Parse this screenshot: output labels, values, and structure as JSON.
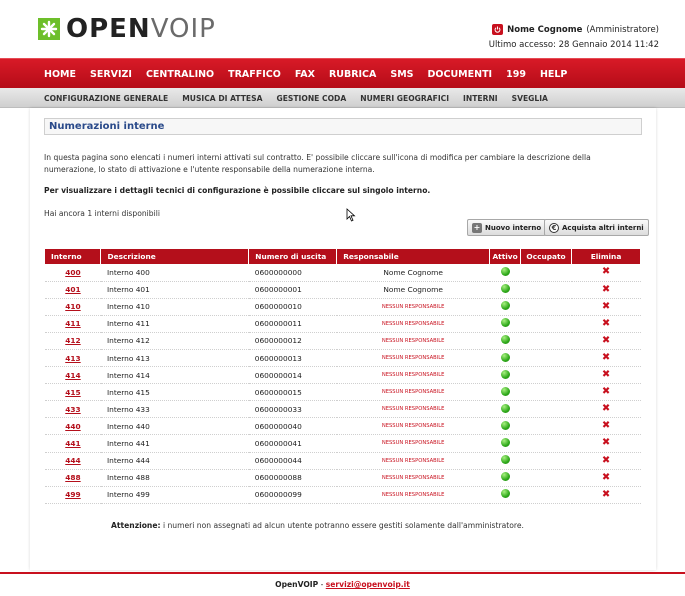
{
  "logo": {
    "word1": "OPEN",
    "word2": "VOIP"
  },
  "user": {
    "name": "Nome Cognome",
    "role": "(Amministratore)",
    "last_access": "Ultimo accesso: 28 Gennaio 2014 11:42"
  },
  "main_nav": [
    "HOME",
    "SERVIZI",
    "CENTRALINO",
    "TRAFFICO",
    "FAX",
    "RUBRICA",
    "SMS",
    "DOCUMENTI",
    "199",
    "HELP"
  ],
  "sub_nav": [
    "CONFIGURAZIONE GENERALE",
    "MUSICA DI ATTESA",
    "GESTIONE CODA",
    "NUMERI GEOGRAFICI",
    "INTERNI",
    "SVEGLIA"
  ],
  "page": {
    "title": "Numerazioni interne",
    "intro": "In questa pagina sono elencati i numeri interni attivati sul contratto. E' possibile cliccare sull'icona di modifica per cambiare la descrizione della numerazione, lo stato di attivazione e l'utente responsabile della numerazione interna.",
    "note": "Per visualizzare i dettagli tecnici di configurazione è possibile cliccare sul singolo interno.",
    "available": "Hai ancora 1 interni disponibili",
    "btn_new": "Nuovo interno",
    "btn_buy": "Acquista altri interni"
  },
  "table": {
    "headers": [
      "Interno",
      "Descrizione",
      "Numero di uscita",
      "Responsabile",
      "Attivo",
      "Occupato",
      "Elimina"
    ],
    "rows": [
      {
        "interno": "400",
        "descrizione": "Interno 400",
        "numero": "0600000000",
        "responsabile": "Nome Cognome"
      },
      {
        "interno": "401",
        "descrizione": "Interno 401",
        "numero": "0600000001",
        "responsabile": "Nome Cognome"
      },
      {
        "interno": "410",
        "descrizione": "Interno 410",
        "numero": "0600000010",
        "responsabile": "NESSUN RESPONSABILE"
      },
      {
        "interno": "411",
        "descrizione": "Interno 411",
        "numero": "0600000011",
        "responsabile": "NESSUN RESPONSABILE"
      },
      {
        "interno": "412",
        "descrizione": "Interno 412",
        "numero": "0600000012",
        "responsabile": "NESSUN RESPONSABILE"
      },
      {
        "interno": "413",
        "descrizione": "Interno 413",
        "numero": "0600000013",
        "responsabile": "NESSUN RESPONSABILE"
      },
      {
        "interno": "414",
        "descrizione": "Interno 414",
        "numero": "0600000014",
        "responsabile": "NESSUN RESPONSABILE"
      },
      {
        "interno": "415",
        "descrizione": "Interno 415",
        "numero": "0600000015",
        "responsabile": "NESSUN RESPONSABILE"
      },
      {
        "interno": "433",
        "descrizione": "Interno 433",
        "numero": "0600000033",
        "responsabile": "NESSUN RESPONSABILE"
      },
      {
        "interno": "440",
        "descrizione": "Interno 440",
        "numero": "0600000040",
        "responsabile": "NESSUN RESPONSABILE"
      },
      {
        "interno": "441",
        "descrizione": "Interno 441",
        "numero": "0600000041",
        "responsabile": "NESSUN RESPONSABILE"
      },
      {
        "interno": "444",
        "descrizione": "Interno 444",
        "numero": "0600000044",
        "responsabile": "NESSUN RESPONSABILE"
      },
      {
        "interno": "488",
        "descrizione": "Interno 488",
        "numero": "0600000088",
        "responsabile": "NESSUN RESPONSABILE"
      },
      {
        "interno": "499",
        "descrizione": "Interno 499",
        "numero": "0600000099",
        "responsabile": "NESSUN RESPONSABILE"
      }
    ]
  },
  "warning": {
    "label": "Attenzione:",
    "text": " i numeri non assegnati ad alcun utente potranno essere gestiti solamente dall'amministratore."
  },
  "footer": {
    "brand": "OpenVOIP",
    "sep": " - ",
    "email": "servizi@openvoip.it"
  },
  "icons": {
    "active": "green-dot-icon",
    "delete": "red-x-icon",
    "power": "power-icon",
    "add": "plus-icon",
    "buy": "euro-icon"
  },
  "colors": {
    "brand_red": "#c8101e",
    "active_green": "#2ea91a"
  }
}
